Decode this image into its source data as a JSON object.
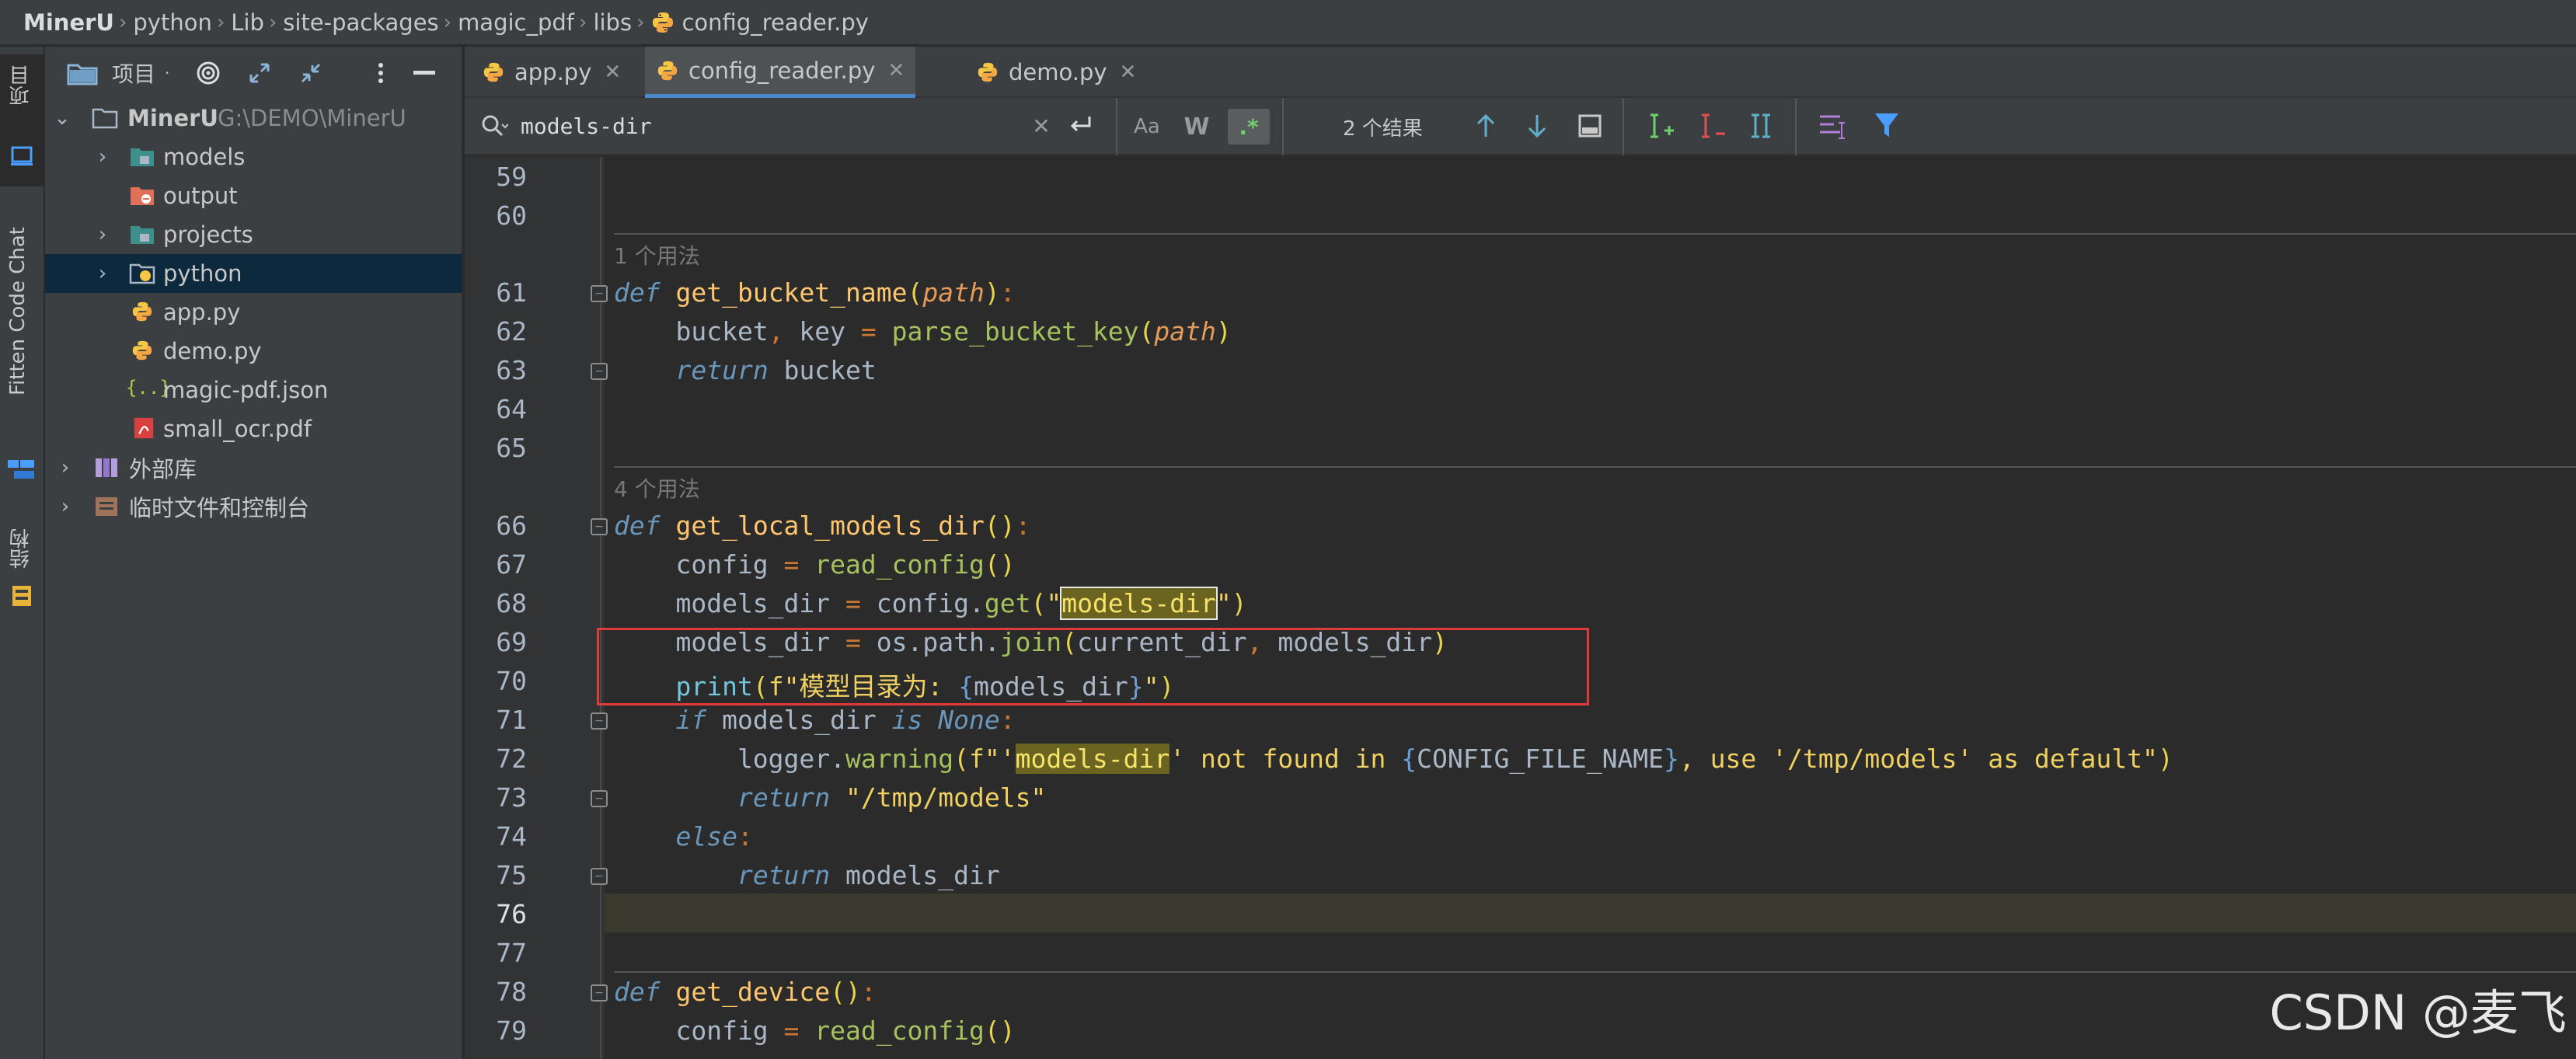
{
  "breadcrumb": [
    "MinerU",
    "python",
    "Lib",
    "site-packages",
    "magic_pdf",
    "libs",
    "config_reader.py"
  ],
  "toolstrip": {
    "project_label": "项目",
    "fitten_label": "Fitten Code Chat",
    "structure_label": "结构"
  },
  "project_panel": {
    "title": "项目",
    "tree": [
      {
        "label": "MinerU",
        "path": "G:\\DEMO\\MinerU",
        "kind": "folder-root",
        "expanded": true
      },
      {
        "label": "models",
        "kind": "folder"
      },
      {
        "label": "output",
        "kind": "folder-excluded"
      },
      {
        "label": "projects",
        "kind": "folder"
      },
      {
        "label": "python",
        "kind": "folder-python",
        "selected": true
      },
      {
        "label": "app.py",
        "kind": "python-file"
      },
      {
        "label": "demo.py",
        "kind": "python-file"
      },
      {
        "label": "magic-pdf.json",
        "kind": "json-file"
      },
      {
        "label": "small_ocr.pdf",
        "kind": "pdf-file"
      },
      {
        "label": "外部库",
        "kind": "library"
      },
      {
        "label": "临时文件和控制台",
        "kind": "scratch"
      }
    ]
  },
  "tabs": [
    {
      "label": "app.py",
      "active": false
    },
    {
      "label": "config_reader.py",
      "active": true
    },
    {
      "label": "demo.py",
      "active": false
    }
  ],
  "search": {
    "query": "models-dir",
    "results": "2 个结果",
    "case_label": "Aa",
    "word_label": "W",
    "regex_label": ".*"
  },
  "code": {
    "lines": [
      "59",
      "60",
      "61",
      "62",
      "63",
      "64",
      "65",
      "66",
      "67",
      "68",
      "69",
      "70",
      "71",
      "72",
      "73",
      "74",
      "75",
      "76",
      "77",
      "78",
      "79"
    ],
    "hint_1": "1 个用法",
    "hint_2": "4 个用法",
    "l61_def": "def",
    "l61_name": "get_bucket_name",
    "l61_param": "path",
    "l62_text": "bucket, key = parse_bucket_key(path)",
    "l63_return": "return",
    "l63_val": " bucket",
    "l66_name": "get_local_models_dir",
    "l67_call": "read_config",
    "l68_key": "models-dir",
    "l70_msg": "模型目录为: ",
    "l71_none": "None",
    "l72_warn": "warning",
    "l72_key": "models-dir",
    "l72_const": "CONFIG_FILE_NAME",
    "l72_tail": ", use '/tmp/models' as default\"",
    "l73_str": "\"/tmp/models\"",
    "l75_val": " models_dir",
    "l78_name": "get_device"
  },
  "watermark": "CSDN @麦飞"
}
